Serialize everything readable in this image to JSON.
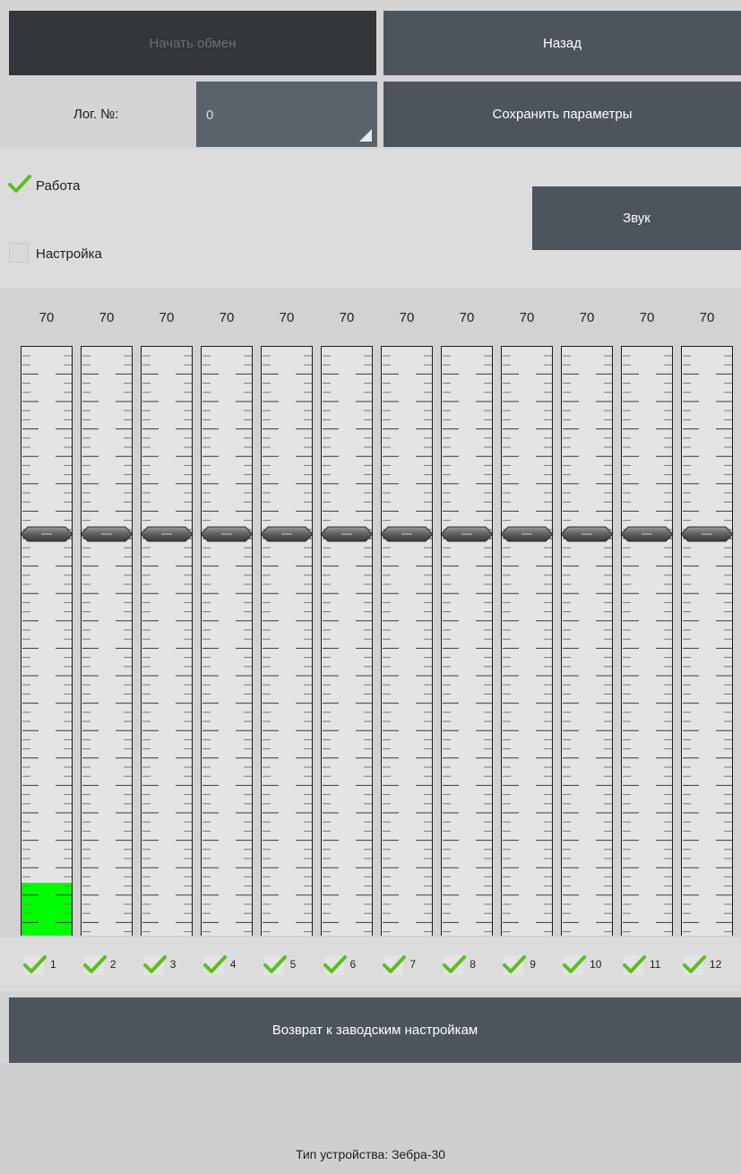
{
  "toolbar": {
    "start_exchange_label": "Начать обмен",
    "back_label": "Назад",
    "save_params_label": "Сохранить параметры"
  },
  "log": {
    "label": "Лог. №:",
    "value": "0"
  },
  "mode": {
    "work_label": "Работа",
    "work_checked": true,
    "setup_label": "Настройка",
    "setup_checked": false
  },
  "sound_label": "Звук",
  "channels": [
    {
      "value_text": "70",
      "value": 70,
      "level": 0.09,
      "number": "1",
      "enabled": true
    },
    {
      "value_text": "70",
      "value": 70,
      "level": 0,
      "number": "2",
      "enabled": true
    },
    {
      "value_text": "70",
      "value": 70,
      "level": 0,
      "number": "3",
      "enabled": true
    },
    {
      "value_text": "70",
      "value": 70,
      "level": 0,
      "number": "4",
      "enabled": true
    },
    {
      "value_text": "70",
      "value": 70,
      "level": 0,
      "number": "5",
      "enabled": true
    },
    {
      "value_text": "70",
      "value": 70,
      "level": 0,
      "number": "6",
      "enabled": true
    },
    {
      "value_text": "70",
      "value": 70,
      "level": 0,
      "number": "7",
      "enabled": true
    },
    {
      "value_text": "70",
      "value": 70,
      "level": 0,
      "number": "8",
      "enabled": true
    },
    {
      "value_text": "70",
      "value": 70,
      "level": 0,
      "number": "9",
      "enabled": true
    },
    {
      "value_text": "70",
      "value": 70,
      "level": 0,
      "number": "10",
      "enabled": true
    },
    {
      "value_text": "70",
      "value": 70,
      "level": 0,
      "number": "11",
      "enabled": true
    },
    {
      "value_text": "70",
      "value": 70,
      "level": 0,
      "number": "12",
      "enabled": true
    }
  ],
  "factory_reset_label": "Возврат к заводским настройкам",
  "device_type": "Тип устройства: Зебра-30",
  "colors": {
    "button": "#4d545c",
    "button_disabled": "#33363a",
    "check": "#5bbf1f",
    "level_fill": "#00ff00"
  }
}
